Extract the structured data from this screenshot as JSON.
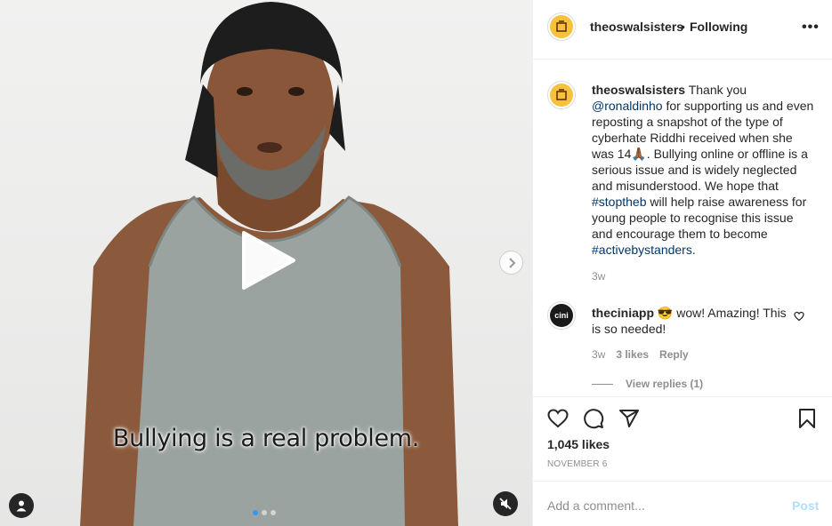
{
  "post": {
    "username": "theoswalsisters",
    "separator": "•",
    "follow_status": "Following",
    "more_label": "•••"
  },
  "media": {
    "caption_overlay": "Bullying is a real problem.",
    "carousel_index": 1,
    "carousel_count": 3,
    "icons": {
      "play": "play-icon",
      "next": "chevron-right-icon",
      "tag": "user-tag-icon",
      "mute": "muted-speaker-icon"
    }
  },
  "caption": {
    "username": "theoswalsisters",
    "text_1": " Thank you ",
    "mention": "@ronaldinho",
    "text_2": " for supporting us and even reposting a snapshot of the type of cyberhate Riddhi received when she was 14🙏🏾. Bullying online or offline is a serious issue and is widely neglected and misunderstood. We hope that ",
    "hashtag_1": "#stoptheb",
    "text_3": " will help raise awareness for young people to recognise this issue and encourage them to become ",
    "hashtag_2": "#activebystanders",
    "text_4": ".",
    "time": "3w"
  },
  "comments": [
    {
      "username": "theciniapp",
      "avatar_label": "cini",
      "text": " 😎 wow! Amazing! This is so needed!",
      "time": "3w",
      "likes": "3 likes",
      "reply_label": "Reply",
      "view_replies": "View replies (1)"
    }
  ],
  "footer": {
    "likes": "1,045 likes",
    "date": "NOVEMBER 6",
    "comment_placeholder": "Add a comment...",
    "post_label": "Post"
  },
  "colors": {
    "link": "#00376b",
    "muted": "#8e8e8e",
    "post_disabled": "#b2dffc",
    "carousel_active": "#3897f0"
  }
}
